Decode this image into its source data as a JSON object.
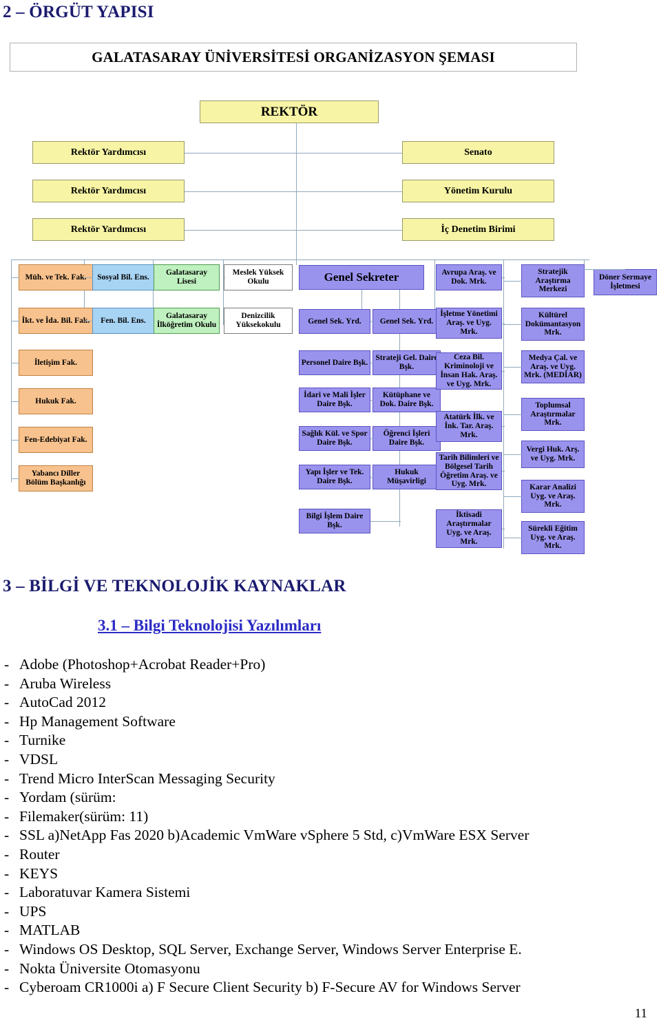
{
  "section2": {
    "heading": "2 – ÖRGÜT YAPISI",
    "chart_title": "GALATASARAY ÜNİVERSİTESİ ORGANİZASYON ŞEMASI"
  },
  "org_chart": {
    "root": {
      "label": "REKTÖR",
      "color": "#F7F5A5"
    },
    "left_top": [
      {
        "label": "Rektör Yardımcısı",
        "color": "#F7F5A5"
      },
      {
        "label": "Rektör Yardımcısı",
        "color": "#F7F5A5"
      },
      {
        "label": "Rektör Yardımcısı",
        "color": "#F7F5A5"
      }
    ],
    "right_top": [
      {
        "label": "Senato",
        "color": "#F7F5A5"
      },
      {
        "label": "Yönetim Kurulu",
        "color": "#F7F5A5"
      },
      {
        "label": "İç Denetim Birimi",
        "color": "#F7F5A5"
      }
    ],
    "col_faculties": [
      {
        "label": "Müh. ve Tek. Fak.",
        "color": "#F8C28E"
      },
      {
        "label": "İkt. ve İda. Bil. Fak.",
        "color": "#F8C28E"
      },
      {
        "label": "İletişim Fak.",
        "color": "#F8C28E"
      },
      {
        "label": "Hukuk Fak.",
        "color": "#F8C28E"
      },
      {
        "label": "Fen-Edebiyat Fak.",
        "color": "#F8C28E"
      },
      {
        "label": "Yabancı Diller Bölüm Başkanlığı",
        "color": "#F8C28E"
      }
    ],
    "col_institutes": [
      {
        "label": "Sosyal Bil. Ens.",
        "color": "#A8D4F4"
      },
      {
        "label": "Fen. Bil. Ens.",
        "color": "#A8D4F4"
      }
    ],
    "col_schools_green": [
      {
        "label": "Galatasaray Lisesi",
        "color": "#BFF0BF"
      },
      {
        "label": "Galatasaray İlköğretim Okulu",
        "color": "#BFF0BF"
      }
    ],
    "col_schools_white": [
      {
        "label": "Meslek Yüksek Okulu",
        "color": "#FFFFFF"
      },
      {
        "label": "Denizcilik Yüksekokulu",
        "color": "#FFFFFF"
      }
    ],
    "general_secretary": {
      "label": "Genel Sekreter",
      "color": "#9A93EE"
    },
    "col_depts_left": [
      {
        "label": "Genel Sek. Yrd.",
        "color": "#9A93EE"
      },
      {
        "label": "Personel Daire Bşk.",
        "color": "#9A93EE"
      },
      {
        "label": "İdari ve Mali İşler Daire Bşk.",
        "color": "#9A93EE"
      },
      {
        "label": "Sağlık Kül. ve Spor Daire Bşk.",
        "color": "#9A93EE"
      },
      {
        "label": "Yapı İşler ve Tek. Daire Bşk.",
        "color": "#9A93EE"
      },
      {
        "label": "Bilgi İşlem Daire Bşk.",
        "color": "#9A93EE"
      }
    ],
    "col_depts_right": [
      {
        "label": "Genel Sek. Yrd.",
        "color": "#9A93EE"
      },
      {
        "label": "Strateji Gel. Daire Bşk.",
        "color": "#9A93EE"
      },
      {
        "label": "Kütüphane ve Dok. Daire Bşk.",
        "color": "#9A93EE"
      },
      {
        "label": "Öğrenci İşleri Daire Bşk.",
        "color": "#9A93EE"
      },
      {
        "label": "Hukuk Müşavirligi",
        "color": "#9A93EE"
      }
    ],
    "col_centers_left": [
      {
        "label": "Avrupa Araş. ve Dok. Mrk.",
        "color": "#9A93EE"
      },
      {
        "label": "İşletme Yönetimi Araş. ve Uyg. Mrk.",
        "color": "#9A93EE"
      },
      {
        "label": "Ceza Bil. Kriminoloji ve İnsan Hak. Araş. ve Uyg. Mrk.",
        "color": "#9A93EE"
      },
      {
        "label": "Atatürk İlk. ve İnk. Tar. Araş. Mrk.",
        "color": "#9A93EE"
      },
      {
        "label": "Tarih Bilimleri ve Bölgesel Tarih Öğretim Araş. ve Uyg. Mrk.",
        "color": "#9A93EE"
      },
      {
        "label": "İktisadi Araştırmalar Uyg. ve Araş. Mrk.",
        "color": "#9A93EE"
      }
    ],
    "col_centers_right": [
      {
        "label": "Stratejik Araştırma Merkezi",
        "color": "#9A93EE"
      },
      {
        "label": "Kültürel Dokümantasyon Mrk.",
        "color": "#9A93EE"
      },
      {
        "label": "Medya Çal. ve Araş. ve Uyg. Mrk. (MEDİAR)",
        "color": "#9A93EE"
      },
      {
        "label": "Toplumsal Araştırmalar Mrk.",
        "color": "#9A93EE"
      },
      {
        "label": "Vergi Huk. Arş. ve Uyg. Mrk.",
        "color": "#9A93EE"
      },
      {
        "label": "Karar Analizi Uyg. ve Araş. Mrk.",
        "color": "#9A93EE"
      },
      {
        "label": "Sürekli Eğitim Uyg. ve Araş. Mrk.",
        "color": "#9A93EE"
      }
    ],
    "revolving_fund": {
      "label": "Döner Sermaye İşletmesi",
      "color": "#9A93EE"
    }
  },
  "section3": {
    "heading": "3 – BİLGİ VE TEKNOLOJİK KAYNAKLAR",
    "subheading": "3.1 – Bilgi Teknolojisi Yazılımları",
    "bullet_marker": "-",
    "items": [
      "Adobe (Photoshop+Acrobat Reader+Pro)",
      "Aruba Wireless",
      "AutoCad 2012",
      "Hp Management Software",
      "Turnike",
      "VDSL",
      "Trend Micro InterScan Messaging Security",
      "Yordam (sürüm:",
      "Filemaker(sürüm: 11)",
      "SSL a)NetApp Fas 2020  b)Academic VmWare vSphere 5 Std,  c)VmWare ESX Server",
      "Router",
      "KEYS",
      "Laboratuvar Kamera Sistemi",
      "UPS",
      "MATLAB",
      "Windows OS Desktop, SQL Server, Exchange Server, Windows Server Enterprise E.",
      "Nokta Üniversite Otomasyonu",
      "Cyberoam CR1000i   a) F Secure Client Security  b) F-Secure AV for Windows Server"
    ]
  },
  "footer": {
    "page_number": "11"
  }
}
